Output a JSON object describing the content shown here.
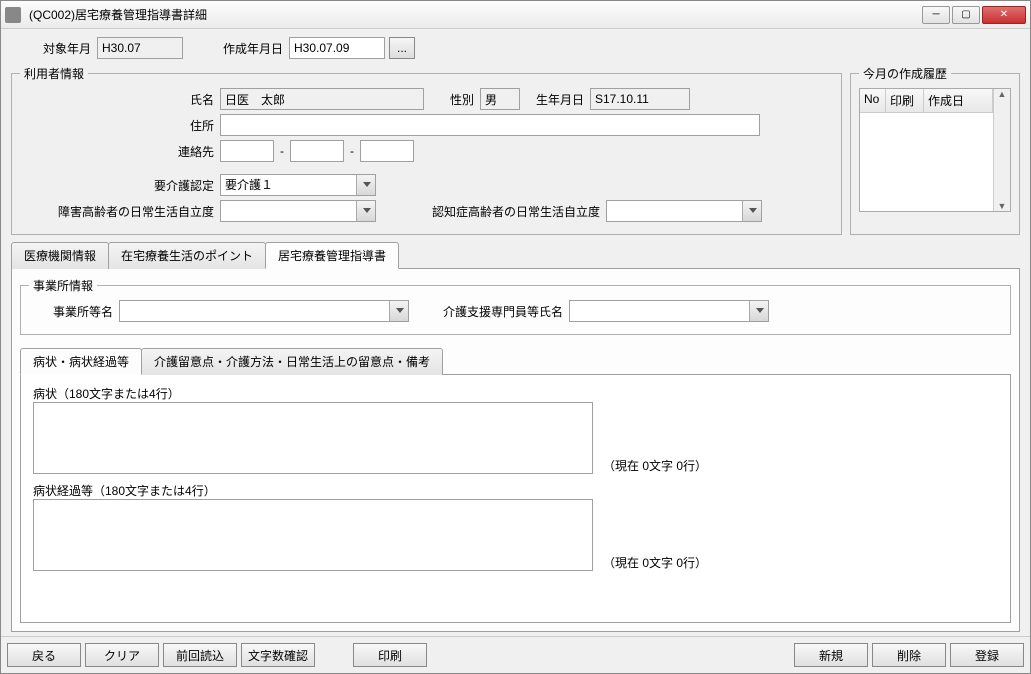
{
  "window": {
    "title": "(QC002)居宅療養管理指導書詳細"
  },
  "header": {
    "target_month_label": "対象年月",
    "target_month_value": "H30.07",
    "created_date_label": "作成年月日",
    "created_date_value": "H30.07.09",
    "date_picker_ellipsis": "..."
  },
  "user_info": {
    "legend": "利用者情報",
    "name_label": "氏名",
    "name_value": "日医　太郎",
    "sex_label": "性別",
    "sex_value": "男",
    "birth_label": "生年月日",
    "birth_value": "S17.10.11",
    "address_label": "住所",
    "address_value": "",
    "contact_label": "連絡先",
    "contact_sep": "-",
    "care_level_label": "要介護認定",
    "care_level_value": "要介護１",
    "disabled_adl_label": "障害高齢者の日常生活自立度",
    "disabled_adl_value": "",
    "dementia_adl_label": "認知症高齢者の日常生活自立度",
    "dementia_adl_value": ""
  },
  "history": {
    "legend": "今月の作成履歴",
    "col_no": "No",
    "col_print": "印刷",
    "col_date": "作成日"
  },
  "tabs_main": {
    "tab1": "医療機関情報",
    "tab2": "在宅療養生活のポイント",
    "tab3": "居宅療養管理指導書"
  },
  "office": {
    "legend": "事業所情報",
    "office_name_label": "事業所等名",
    "office_name_value": "",
    "care_mgr_label": "介護支援専門員等氏名",
    "care_mgr_value": ""
  },
  "tabs_inner": {
    "tab1": "病状・病状経過等",
    "tab2": "介護留意点・介護方法・日常生活上の留意点・備考"
  },
  "condition": {
    "section1_label": "病状（180文字または4行）",
    "section2_label": "病状経過等（180文字または4行）",
    "counter1": "（現在 0文字 0行）",
    "counter2": "（現在 0文字 0行）"
  },
  "buttons": {
    "back": "戻る",
    "clear": "クリア",
    "prev_load": "前回読込",
    "char_check": "文字数確認",
    "print": "印刷",
    "new": "新規",
    "delete": "削除",
    "register": "登録"
  }
}
